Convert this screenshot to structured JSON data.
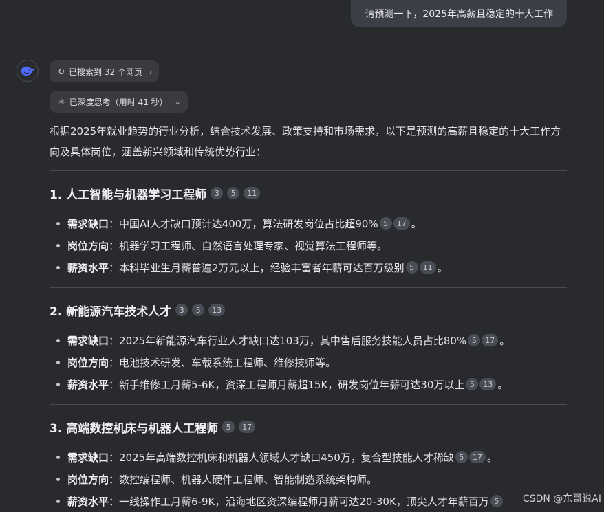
{
  "user_message": "请预测一下，2025年高薪且稳定的十大工作",
  "chips": {
    "search": {
      "label": "已搜索到 32 个网页",
      "icon": "refresh-search-icon"
    },
    "thinking": {
      "label": "已深度思考（用时 41 秒）",
      "icon": "atom-icon"
    }
  },
  "intro": "根据2025年就业趋势的行业分析，结合技术发展、政策支持和市场需求，以下是预测的高薪且稳定的十大工作方向及具体岗位，涵盖新兴领域和传统优势行业：",
  "sections": [
    {
      "title": "1. 人工智能与机器学习工程师",
      "badges": [
        "3",
        "5",
        "11"
      ],
      "items": [
        {
          "key": "需求缺口",
          "sep": "：",
          "text": "中国AI人才缺口预计达400万，算法研发岗位占比超90%",
          "badges": [
            "5",
            "17"
          ],
          "end": "。"
        },
        {
          "key": "岗位方向",
          "sep": "：",
          "text": "机器学习工程师、自然语言处理专家、视觉算法工程师等。",
          "badges": [],
          "end": ""
        },
        {
          "key": "薪资水平",
          "sep": "：",
          "text": "本科毕业生月薪普遍2万元以上，经验丰富者年薪可达百万级别",
          "badges": [
            "5",
            "11"
          ],
          "end": "。"
        }
      ]
    },
    {
      "title": "2. 新能源汽车技术人才",
      "badges": [
        "3",
        "5",
        "13"
      ],
      "items": [
        {
          "key": "需求缺口",
          "sep": "：",
          "text": "2025年新能源汽车行业人才缺口达103万，其中售后服务技能人员占比80%",
          "badges": [
            "5",
            "17"
          ],
          "end": "。"
        },
        {
          "key": "岗位方向",
          "sep": "：",
          "text": "电池技术研发、车载系统工程师、维修技师等。",
          "badges": [],
          "end": ""
        },
        {
          "key": "薪资水平",
          "sep": "：",
          "text": "新手维修工月薪5-6K，资深工程师月薪超15K，研发岗位年薪可达30万以上",
          "badges": [
            "5",
            "13"
          ],
          "end": "。"
        }
      ]
    },
    {
      "title": "3. 高端数控机床与机器人工程师",
      "badges": [
        "5",
        "17"
      ],
      "items": [
        {
          "key": "需求缺口",
          "sep": "：",
          "text": "2025年高端数控机床和机器人领域人才缺口450万，复合型技能人才稀缺",
          "badges": [
            "5",
            "17"
          ],
          "end": "。"
        },
        {
          "key": "岗位方向",
          "sep": "：",
          "text": "数控编程师、机器人硬件工程师、智能制造系统架构师。",
          "badges": [],
          "end": ""
        },
        {
          "key": "薪资水平",
          "sep": "：",
          "text": "一线操作工月薪6-9K，沿海地区资深编程师月薪可达20-30K，顶尖人才年薪百万",
          "badges": [
            "5"
          ],
          "end": ""
        }
      ]
    }
  ],
  "watermark": "CSDN @东哥说AI"
}
